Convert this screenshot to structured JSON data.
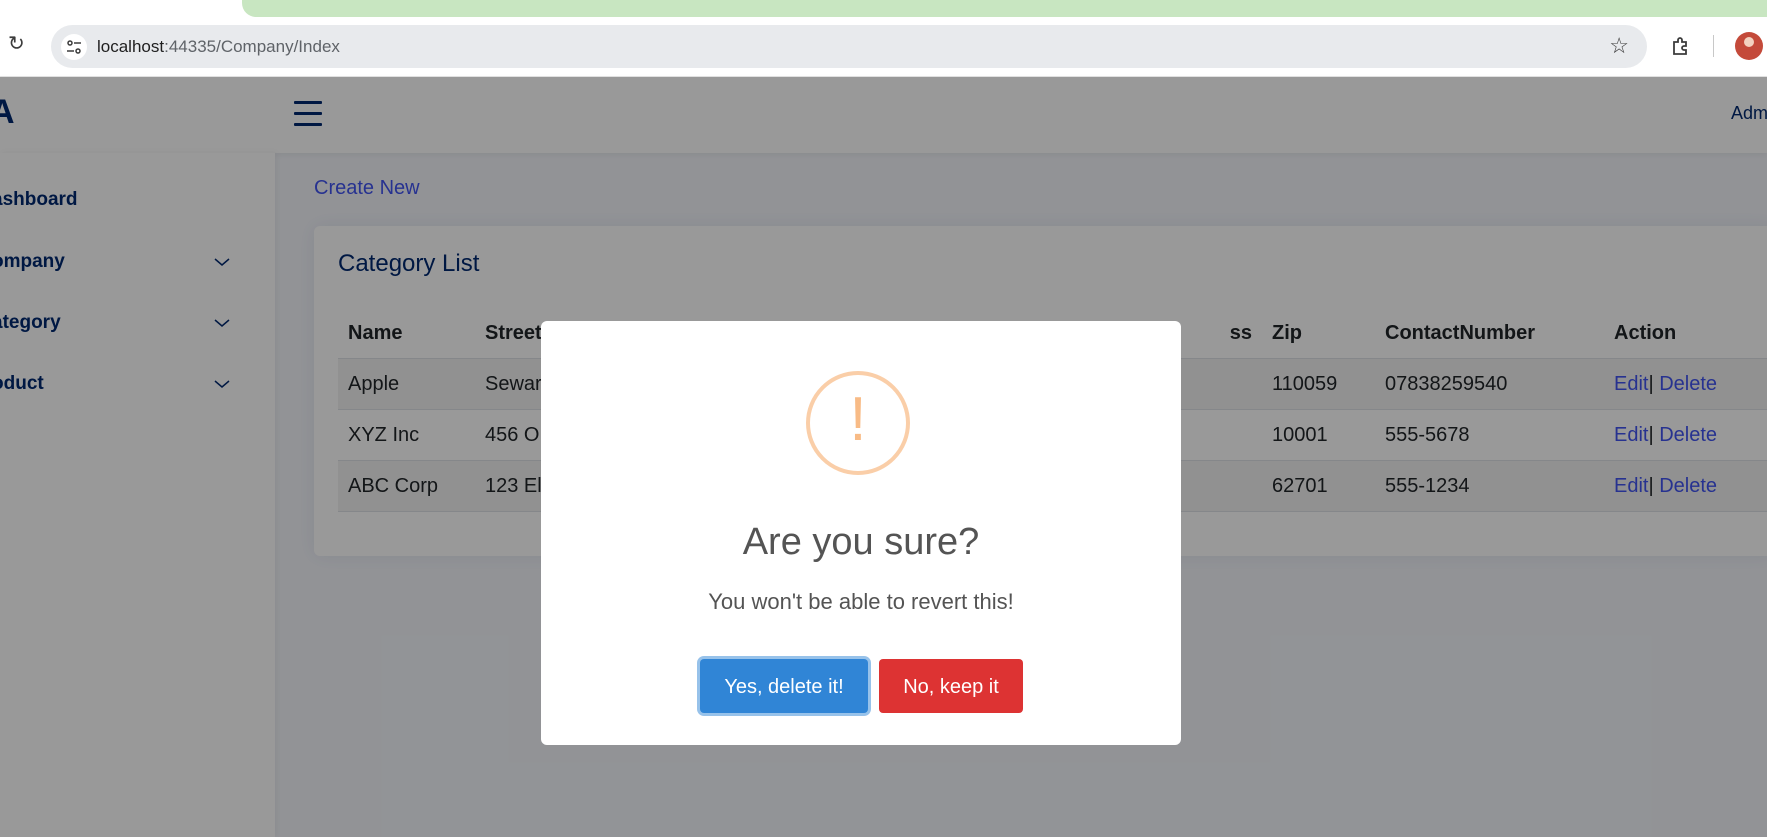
{
  "browser": {
    "url_host": "localhost",
    "url_path": ":44335/Company/Index"
  },
  "header": {
    "brand": "A",
    "admin": "Adm"
  },
  "sidebar": {
    "items": [
      {
        "label": "ashboard",
        "has_chevron": false
      },
      {
        "label": "ompany",
        "has_chevron": true
      },
      {
        "label": "ategory",
        "has_chevron": true
      },
      {
        "label": "oduct",
        "has_chevron": true
      }
    ]
  },
  "main": {
    "create_new": "Create New",
    "card_title": "Category List",
    "table": {
      "headers": [
        "Name",
        "Street",
        "ss",
        "Zip",
        "ContactNumber",
        "Action"
      ],
      "rows": [
        {
          "name": "Apple",
          "street": "Sewar",
          "zip": "110059",
          "contact": "07838259540"
        },
        {
          "name": "XYZ Inc",
          "street": "456 O",
          "zip": "10001",
          "contact": "555-5678"
        },
        {
          "name": "ABC Corp",
          "street": "123 El",
          "zip": "62701",
          "contact": "555-1234"
        }
      ],
      "edit_label": "Edit",
      "separator": "|",
      "delete_label": "Delete"
    }
  },
  "modal": {
    "icon": "!",
    "title": "Are you sure?",
    "text": "You won't be able to revert this!",
    "confirm_label": "Yes, delete it!",
    "cancel_label": "No, keep it"
  },
  "colors": {
    "brand": "#012970",
    "link": "#4154f1",
    "confirm": "#3085d6",
    "cancel": "#dd3333",
    "warning": "#f8bb86"
  }
}
